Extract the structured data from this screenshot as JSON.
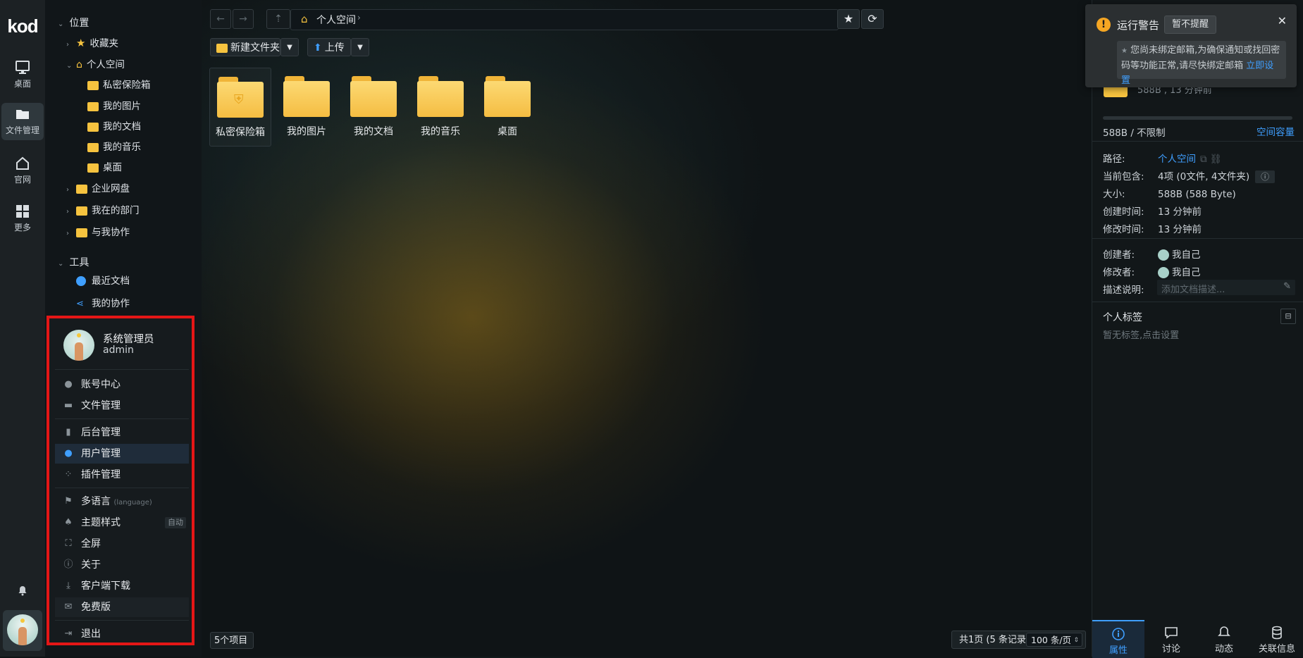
{
  "rail": {
    "logo": "kod",
    "items": [
      {
        "label": "桌面",
        "icon": "monitor-icon"
      },
      {
        "label": "文件管理",
        "icon": "folder-icon"
      },
      {
        "label": "官网",
        "icon": "home-icon"
      },
      {
        "label": "更多",
        "icon": "grid-icon"
      }
    ]
  },
  "tree": {
    "position_header": "位置",
    "items": {
      "favorites": "收藏夹",
      "personal": "个人空间",
      "vault": "私密保险箱",
      "pictures": "我的图片",
      "documents": "我的文档",
      "music": "我的音乐",
      "desktop": "桌面",
      "enterprise": "企业网盘",
      "department": "我在的部门",
      "collab": "与我协作"
    },
    "tools_header": "工具",
    "tools": {
      "recent": "最近文档",
      "mycollab": "我的协作"
    }
  },
  "user_menu": {
    "name": "系统管理员",
    "username": "admin",
    "items": {
      "account": "账号中心",
      "files": "文件管理",
      "admin": "后台管理",
      "users": "用户管理",
      "plugins": "插件管理",
      "language": "多语言",
      "language_hint": "(language)",
      "theme": "主题样式",
      "theme_badge": "自动",
      "fullscreen": "全屏",
      "about": "关于",
      "client": "客户端下载",
      "edition": "免费版",
      "logout": "退出"
    }
  },
  "toolbar": {
    "breadcrumb": "个人空间",
    "new_folder": "新建文件夹",
    "upload": "上传"
  },
  "files": [
    "私密保险箱",
    "我的图片",
    "我的文档",
    "我的音乐",
    "桌面"
  ],
  "footer": {
    "count": "5个项目",
    "pages": "共1页 (5 条记录)",
    "per_page": "100 条/页"
  },
  "warning": {
    "title": "运行警告",
    "dismiss": "暂不提醒",
    "message": "您尚未绑定邮箱,为确保通知或找回密码等功能正常,请尽快绑定邮箱",
    "action": "立即设置"
  },
  "panel": {
    "header_meta": "588B , 13 分钟前",
    "usage": "588B / 不限制",
    "capacity_link": "空间容量",
    "path_k": "路径:",
    "path_v": "个人空间",
    "contains_k": "当前包含:",
    "contains_v": "4项 (0文件, 4文件夹)",
    "size_k": "大小:",
    "size_v": "588B (588 Byte)",
    "created_k": "创建时间:",
    "created_v": "13 分钟前",
    "modified_k": "修改时间:",
    "modified_v": "13 分钟前",
    "creator_k": "创建者:",
    "creator_v": "我自己",
    "modifier_k": "修改者:",
    "modifier_v": "我自己",
    "desc_k": "描述说明:",
    "desc_placeholder": "添加文档描述...",
    "tags_title": "个人标签",
    "tags_empty": "暂无标签,点击设置",
    "tabs": [
      "属性",
      "讨论",
      "动态",
      "关联信息"
    ]
  },
  "colors": {
    "accent": "#3f9fff",
    "highlight_border": "#e41616",
    "folder": "#f6c33f"
  }
}
